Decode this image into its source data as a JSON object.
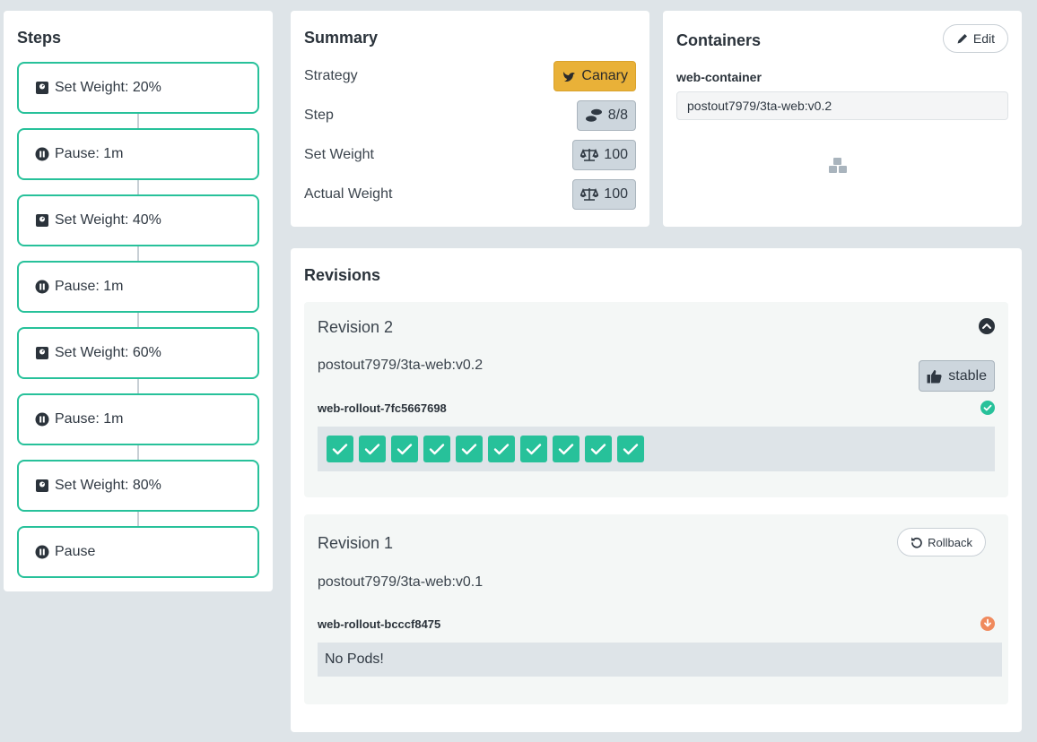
{
  "steps": {
    "title": "Steps",
    "items": [
      {
        "type": "weight",
        "label": "Set Weight: 20%"
      },
      {
        "type": "pause",
        "label": "Pause: 1m"
      },
      {
        "type": "weight",
        "label": "Set Weight: 40%"
      },
      {
        "type": "pause",
        "label": "Pause: 1m"
      },
      {
        "type": "weight",
        "label": "Set Weight: 60%"
      },
      {
        "type": "pause",
        "label": "Pause: 1m"
      },
      {
        "type": "weight",
        "label": "Set Weight: 80%"
      },
      {
        "type": "pause",
        "label": "Pause"
      }
    ]
  },
  "summary": {
    "title": "Summary",
    "strategy_label": "Strategy",
    "strategy_value": "Canary",
    "step_label": "Step",
    "step_value": "8/8",
    "set_weight_label": "Set Weight",
    "set_weight_value": "100",
    "actual_weight_label": "Actual Weight",
    "actual_weight_value": "100"
  },
  "containers": {
    "title": "Containers",
    "edit_label": "Edit",
    "name": "web-container",
    "image": "postout7979/3ta-web:v0.2"
  },
  "revisions": {
    "title": "Revisions",
    "items": [
      {
        "title": "Revision 2",
        "image": "postout7979/3ta-web:v0.2",
        "badge": "stable",
        "replicaset": "web-rollout-7fc5667698",
        "status_icon": "check-circle-icon",
        "pods": 10
      },
      {
        "title": "Revision 1",
        "image": "postout7979/3ta-web:v0.1",
        "action": "Rollback",
        "replicaset": "web-rollout-bcccf8475",
        "status_icon": "arrow-down-circle-icon",
        "empty_text": "No Pods!"
      }
    ]
  },
  "colors": {
    "accent": "#27c19a",
    "canary": "#e9b138",
    "scaled_down": "#f08a5d",
    "neutral_pill": "#cdd6dd"
  }
}
